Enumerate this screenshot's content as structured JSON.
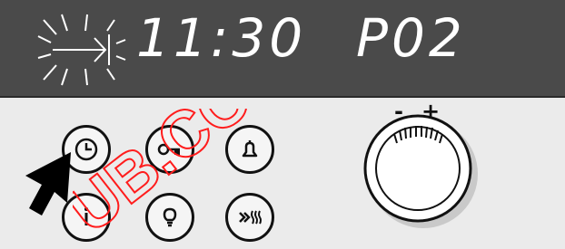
{
  "display": {
    "time": "11:30",
    "program": "P02"
  },
  "knob": {
    "minus_label": "-",
    "plus_label": "+"
  },
  "buttons": [
    {
      "icon": "clock-icon"
    },
    {
      "icon": "key-lock-icon"
    },
    {
      "icon": "bell-icon"
    },
    {
      "icon": "info-icon"
    },
    {
      "icon": "lamp-icon"
    },
    {
      "icon": "fast-heat-icon"
    }
  ],
  "watermark": "UB.COM",
  "colors": {
    "display_bg": "#4a4a4a",
    "display_text": "#ffffff",
    "watermark": "#ff1c1c"
  }
}
